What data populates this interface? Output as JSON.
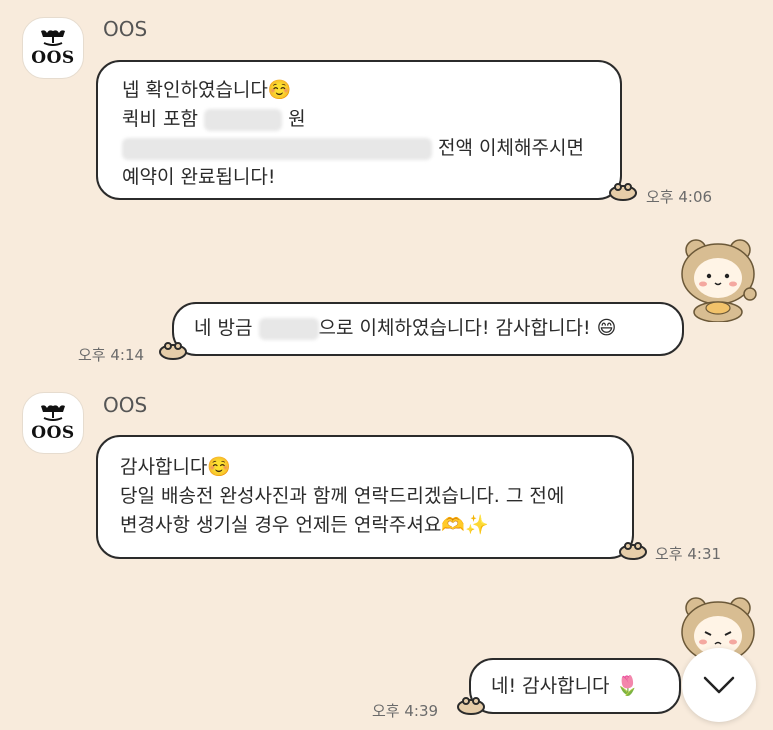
{
  "messages": [
    {
      "sender": "OOS",
      "logo_text": "OOS",
      "lines": [
        "넵 확인하였습니다",
        "퀵비 포함",
        "원",
        "전액 이체해주시면",
        "예약이 완료됩니다!"
      ],
      "emoji": "☺️",
      "time": "오후 4:06"
    },
    {
      "sender": "me",
      "text_a": "네 방금",
      "text_b": "으로 이체하였습니다! 감사합니다!",
      "emoji": "😄",
      "time": "오후 4:14"
    },
    {
      "sender": "OOS",
      "logo_text": "OOS",
      "lines": [
        "감사합니다",
        "당일 배송전 완성사진과 함께 연락드리겠습니다. 그 전에",
        "변경사항 생기실 경우 언제든 연락주셔요"
      ],
      "emoji": "☺️",
      "emoji_end": "🫶✨",
      "time": "오후 4:31"
    },
    {
      "sender": "me",
      "text": "네! 감사합니다",
      "emoji": "🌷",
      "time": "오후 4:39"
    }
  ],
  "icons": {
    "scroll": "chevron-down-icon",
    "avatar": "oos-logo",
    "profile": "bear-hood-character",
    "tail": "paw-icon"
  },
  "colors": {
    "background": "#f8ebdc",
    "bubble_border": "#2b2b2b",
    "bubble_fill": "#ffffff"
  }
}
